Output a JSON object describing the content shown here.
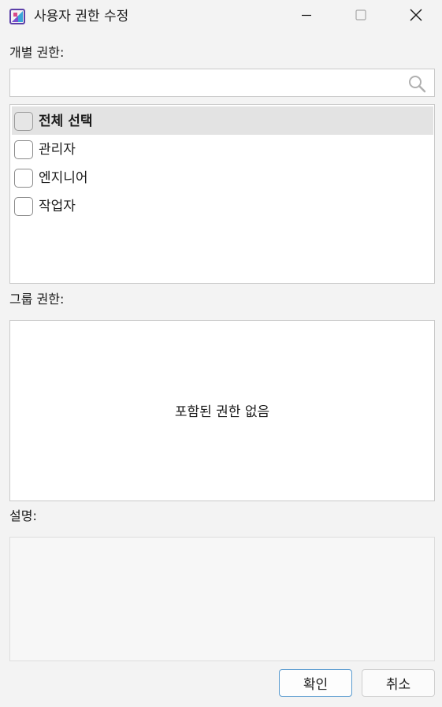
{
  "window": {
    "title": "사용자 권한 수정",
    "app_icon": "app-logo-icon",
    "controls": {
      "minimize_icon": "minimize-icon",
      "maximize_icon": "maximize-icon",
      "close_icon": "close-icon"
    }
  },
  "individual": {
    "label": "개별 권한:",
    "search": {
      "value": "",
      "placeholder": "",
      "icon": "search-icon"
    },
    "items": [
      {
        "label": "전체 선택",
        "checked": false,
        "highlighted": true
      },
      {
        "label": "관리자",
        "checked": false,
        "highlighted": false
      },
      {
        "label": "엔지니어",
        "checked": false,
        "highlighted": false
      },
      {
        "label": "작업자",
        "checked": false,
        "highlighted": false
      }
    ]
  },
  "group": {
    "label": "그룹 권한:",
    "empty_text": "포함된 권한 없음"
  },
  "description": {
    "label": "설명:",
    "value": ""
  },
  "buttons": {
    "ok_label": "확인",
    "cancel_label": "취소"
  },
  "colors": {
    "background": "#f3f3f3",
    "highlight_row": "#e3e3e3",
    "focus_border": "#5a9bd0"
  }
}
